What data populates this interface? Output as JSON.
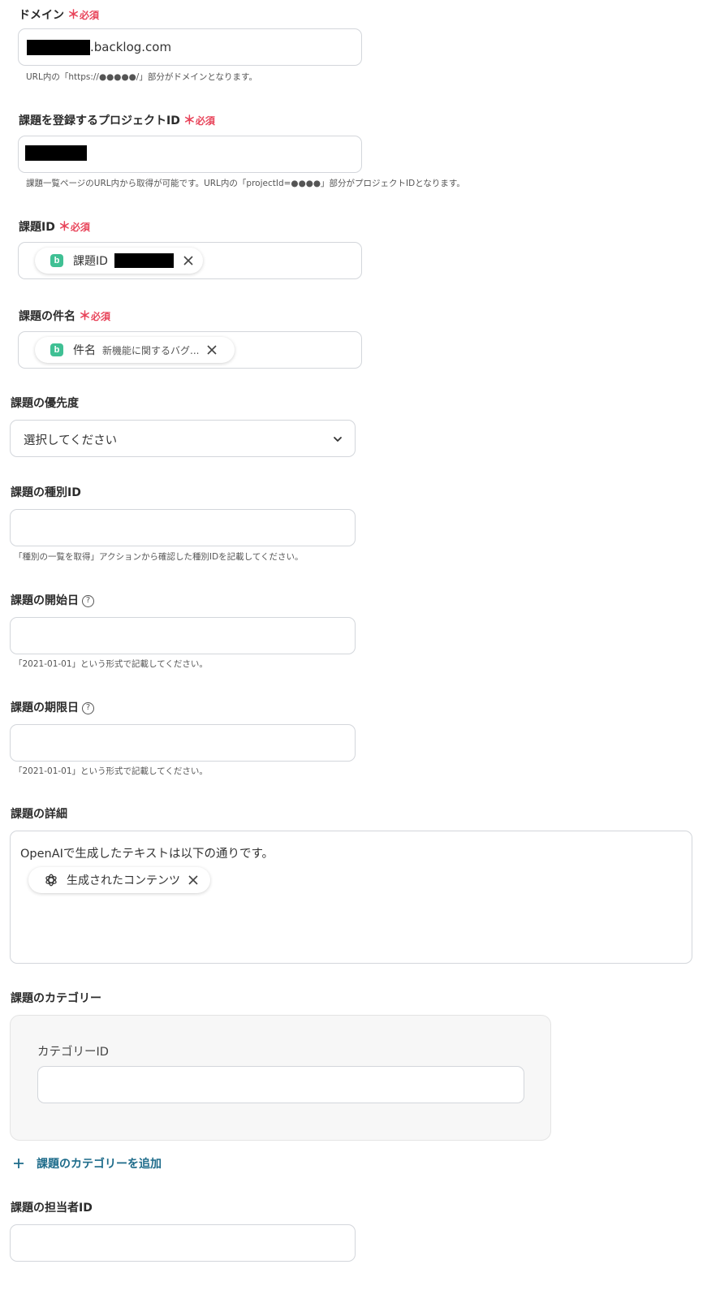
{
  "domain": {
    "label": "ドメイン",
    "required": "必須",
    "value_suffix": ".backlog.com",
    "help": "URL内の「https://●●●●●/」部分がドメインとなります。"
  },
  "project": {
    "label": "課題を登録するプロジェクトID",
    "required": "必須",
    "help": "課題一覧ページのURL内から取得が可能です。URL内の「projectId=●●●●」部分がプロジェクトIDとなります。"
  },
  "issue_id": {
    "label": "課題ID",
    "required": "必須",
    "chip_label": "課題ID",
    "chip_icon": "backlog-icon"
  },
  "issue_subject": {
    "label": "課題の件名",
    "required": "必須",
    "chip_label": "件名",
    "chip_value": "新機能に関するバグ...",
    "chip_icon": "backlog-icon"
  },
  "priority": {
    "label": "課題の優先度",
    "selected": "選択してください"
  },
  "issue_type": {
    "label": "課題の種別ID",
    "help": "「種別の一覧を取得」アクションから確認した種別IDを記載してください。"
  },
  "start_date": {
    "label": "課題の開始日",
    "help": "「2021-01-01」という形式で記載してください。"
  },
  "due_date": {
    "label": "課題の期限日",
    "help": "「2021-01-01」という形式で記載してください。"
  },
  "details": {
    "label": "課題の詳細",
    "text": "OpenAIで生成したテキストは以下の通りです。",
    "chip_label": "生成されたコンテンツ",
    "chip_icon": "openai-icon"
  },
  "category": {
    "label": "課題のカテゴリー",
    "field_label": "カテゴリーID",
    "add_label": "課題のカテゴリーを追加"
  },
  "assignee": {
    "label": "課題の担当者ID"
  },
  "colors": {
    "required": "#e8445a",
    "accent": "#1d6b8a",
    "backlog": "#3fc094"
  }
}
